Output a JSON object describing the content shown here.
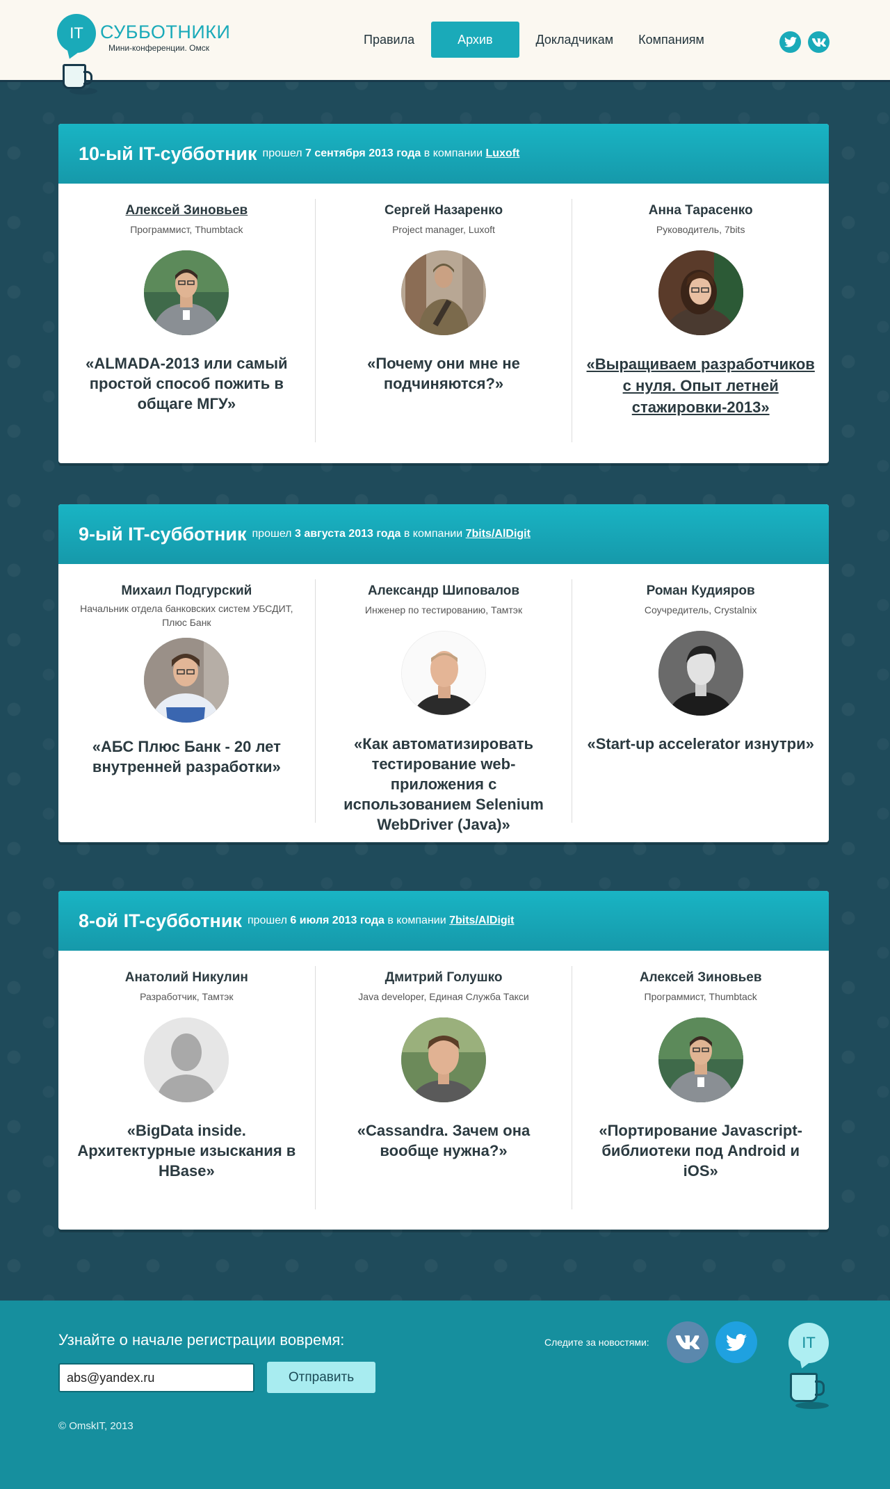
{
  "header": {
    "logo_text": "IT",
    "logo_title": "СУББОТНИКИ",
    "logo_subtitle": "Мини-конференции. Омск",
    "nav": [
      "Правила",
      "Архив",
      "Докладчикам",
      "Компаниям"
    ],
    "active_nav": "Архив"
  },
  "events": [
    {
      "title": "10-ый IT-субботник",
      "prefix": "прошел",
      "date": "7 сентября 2013 года",
      "company_prefix": "в компании",
      "company": "Luxoft",
      "speakers": [
        {
          "name": "Алексей Зиновьев",
          "role": "Программист, Thumbtack",
          "talk": "«ALMADA-2013 или самый простой способ пожить в общаге МГУ»",
          "photo": "photo-man-gray-shirt"
        },
        {
          "name": "Сергей Назаренко",
          "role": "Project manager, Luxoft",
          "talk": "«Почему они мне не подчиняются?»",
          "photo": "photo-man-camouflage"
        },
        {
          "name": "Анна Тарасенко",
          "role": "Руководитель, 7bits",
          "talk": "«Выращиваем разработчиков с нуля. Опыт летней стажировки-2013»",
          "photo": "photo-woman"
        }
      ]
    },
    {
      "title": "9-ый IT-субботник",
      "prefix": "прошел",
      "date": "3 августа 2013 года",
      "company_prefix": "в компании",
      "company": "7bits/AlDigit",
      "speakers": [
        {
          "name": "Михаил Подгурский",
          "role": "Начальник отдела банковских систем УБСДИТ, Плюс Банк",
          "talk": "«АБС Плюс Банк - 20 лет внутренней разработки»",
          "photo": "photo-man-glasses"
        },
        {
          "name": "Александр Шиповалов",
          "role": "Инженер по тестированию, Тамтэк",
          "talk": "«Как автоматизировать тестирование web-приложения с использованием Selenium WebDriver (Java)»",
          "photo": "photo-man-white-bg"
        },
        {
          "name": "Роман Кудияров",
          "role": "Соучредитель, Crystalnix",
          "talk": "«Start-up accelerator изнутри»",
          "photo": "photo-man-bw"
        }
      ]
    },
    {
      "title": "8-ой IT-субботник",
      "prefix": "прошел",
      "date": "6 июля 2013 года",
      "company_prefix": "в компании",
      "company": "7bits/AlDigit",
      "speakers": [
        {
          "name": "Анатолий Никулин",
          "role": "Разработчик, Тамтэк",
          "talk": "«BigData inside. Архитектурные изыскания в HBase»",
          "photo": "placeholder-silhouette"
        },
        {
          "name": "Дмитрий Голушко",
          "role": "Java developer, Единая Служба Такси",
          "talk": "«Cassandra. Зачем она вообще нужна?»",
          "photo": "photo-man-outdoor"
        },
        {
          "name": "Алексей Зиновьев",
          "role": "Программист, Thumbtack",
          "talk": "«Портирование Javascript-библиотеки под Android и iOS»",
          "photo": "photo-man-gray-shirt"
        }
      ]
    }
  ],
  "footer": {
    "label": "Узнайте о начале регистрации вовремя:",
    "email_value": "abs@yandex.ru",
    "submit": "Отправить",
    "follow": "Следите за новостями:",
    "copyright": "© OmskIT, 2013",
    "logo_text": "IT"
  },
  "colors": {
    "accent": "#1aaab9",
    "background": "#1f4b5b",
    "footer": "#168f9e",
    "header_bg": "#fbf8f1"
  }
}
